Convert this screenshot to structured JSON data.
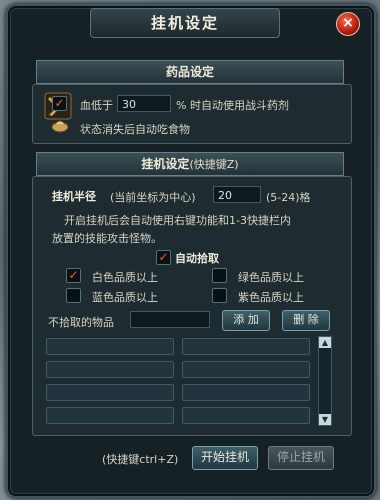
{
  "window": {
    "title": "挂机设定",
    "close_label": "×"
  },
  "potions": {
    "header": "药品设定",
    "hp_prefix": "血低于",
    "hp_value": "30",
    "hp_suffix": "% 时自动使用战斗药剂",
    "food_label": "状态消失后自动吃食物"
  },
  "idle": {
    "header": "挂机设定",
    "header_hotkey": "(快捷键Z)",
    "radius_label": "挂机半径",
    "radius_hint": "(当前坐标为中心)",
    "radius_value": "20",
    "radius_range": "(5-24)格",
    "desc_line1": "开启挂机后会自动使用右键功能和1-3快捷栏内",
    "desc_line2": "放置的技能攻击怪物。"
  },
  "pickup": {
    "auto_label": "自动拾取",
    "auto_checked": true,
    "options": [
      {
        "label": "白色品质以上",
        "checked": true
      },
      {
        "label": "绿色品质以上",
        "checked": false
      },
      {
        "label": "蓝色品质以上",
        "checked": false
      },
      {
        "label": "紫色品质以上",
        "checked": false
      }
    ],
    "exclude_label": "不拾取的物品",
    "exclude_value": "",
    "add_button": "添 加",
    "delete_button": "删 除"
  },
  "footer": {
    "hotkey_hint": "(快捷键ctrl+Z)",
    "start_button": "开始挂机",
    "stop_button": "停止挂机"
  },
  "colors": {
    "check_mark": "#ff5a1f",
    "accent": "#ff6a4a"
  },
  "icons": {
    "potion": "sword-potion-icon",
    "food": "food-icon",
    "close": "close-icon"
  }
}
